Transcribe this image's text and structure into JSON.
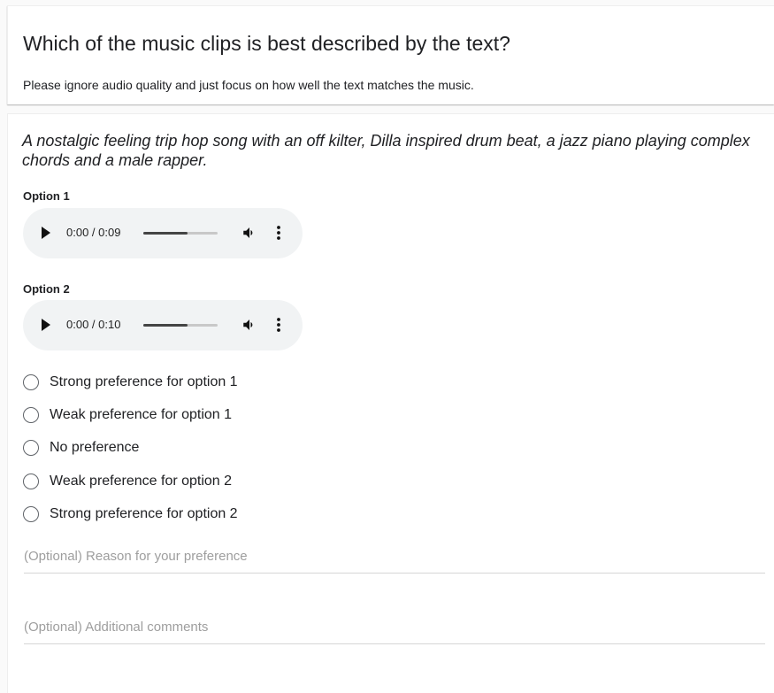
{
  "header": {
    "title": "Which of the music clips is best described by the text?",
    "subtitle": "Please ignore audio quality and just focus on how well the text matches the music."
  },
  "prompt": {
    "text": "A nostalgic feeling trip hop song with an off kilter, Dilla inspired drum beat, a jazz piano playing complex chords and a male rapper."
  },
  "options": [
    {
      "label": "Option 1",
      "player": {
        "time": "0:00 / 0:09",
        "volume_level": 0.6,
        "icons": [
          "play-icon",
          "volume-icon",
          "more-vert-icon"
        ]
      }
    },
    {
      "label": "Option 2",
      "player": {
        "time": "0:00 / 0:10",
        "volume_level": 0.6,
        "icons": [
          "play-icon",
          "volume-icon",
          "more-vert-icon"
        ]
      }
    }
  ],
  "preferences": [
    "Strong preference for option 1",
    "Weak preference for option 1",
    "No preference",
    "Weak preference for option 2",
    "Strong preference for option 2"
  ],
  "fields": {
    "reason_placeholder": "(Optional) Reason for your preference",
    "comments_placeholder": "(Optional) Additional comments",
    "reason_value": "",
    "comments_value": ""
  },
  "colors": {
    "text": "#202124",
    "player_bg": "#f1f3f4",
    "radio_border": "#5f6368",
    "placeholder": "#9e9e9e"
  }
}
